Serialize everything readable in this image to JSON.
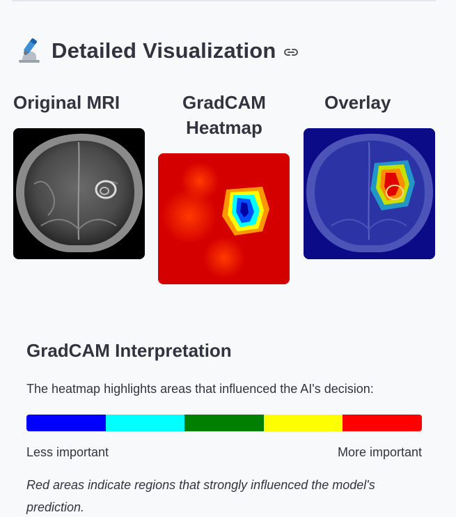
{
  "header": {
    "title": "Detailed Visualization",
    "title_icon": "microscope-icon",
    "anchor_icon": "link-icon"
  },
  "panels": [
    {
      "title": "Original MRI"
    },
    {
      "title": "GradCAM Heatmap"
    },
    {
      "title": "Overlay"
    }
  ],
  "interpretation": {
    "title": "GradCAM Interpretation",
    "description": "The heatmap highlights areas that influenced the AI's decision:",
    "scale_colors": [
      "#0000ff",
      "#00ffff",
      "#008000",
      "#ffff00",
      "#ff0000"
    ],
    "low_label": "Less important",
    "high_label": "More important",
    "note": "Red areas indicate regions that strongly influenced the model's prediction."
  },
  "colors": {
    "background": "#f8f9fb",
    "text": "#31333f"
  }
}
